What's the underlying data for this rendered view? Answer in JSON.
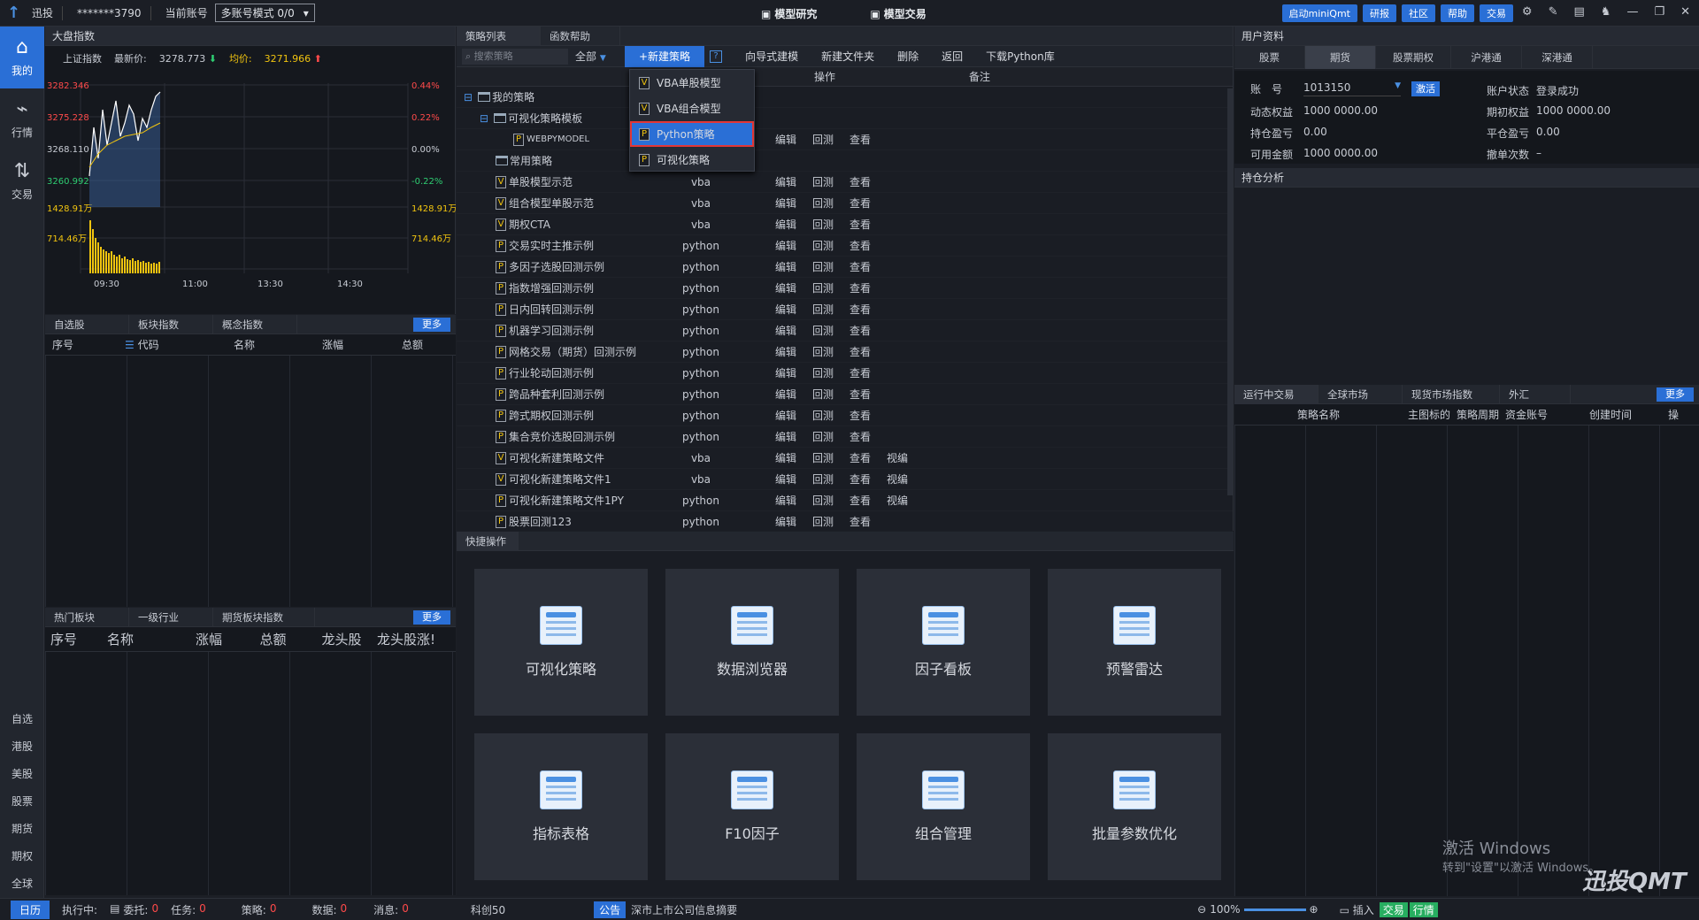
{
  "titlebar": {
    "app_name": "迅投",
    "account_masked": "*******3790",
    "current_account_label": "当前账号",
    "account_mode": "多账号模式 0/0",
    "tabs": [
      "模型研究",
      "模型交易"
    ],
    "buttons": [
      "启动miniQmt",
      "研报",
      "社区",
      "帮助",
      "交易"
    ]
  },
  "leftnav": {
    "items": [
      {
        "label": "我的",
        "icon": "home-icon"
      },
      {
        "label": "行情",
        "icon": "chart-icon"
      },
      {
        "label": "交易",
        "icon": "trade-icon"
      }
    ],
    "bottom_items": [
      "自选",
      "港股",
      "美股",
      "股票",
      "期货",
      "期权",
      "全球"
    ]
  },
  "market": {
    "title": "大盘指数",
    "index_name": "上证指数",
    "last_label": "最新价:",
    "last_value": "3278.773",
    "avg_label": "均价:",
    "avg_value": "3271.966",
    "y_left": [
      "3282.346",
      "3275.228",
      "3268.110",
      "3260.992",
      "1428.91万",
      "714.46万"
    ],
    "y_right": [
      "0.44%",
      "0.22%",
      "0.00%",
      "-0.22%",
      "1428.91万",
      "714.46万"
    ],
    "x_ticks": [
      "09:30",
      "11:00",
      "13:30",
      "14:30"
    ]
  },
  "watch": {
    "tabs": [
      "自选股",
      "板块指数",
      "概念指数"
    ],
    "more": "更多",
    "columns": [
      "序号",
      "代码",
      "名称",
      "涨幅",
      "总额"
    ]
  },
  "hot": {
    "tabs": [
      "热门板块",
      "一级行业",
      "期货板块指数"
    ],
    "more": "更多",
    "columns": [
      "序号",
      "名称",
      "涨幅",
      "总额",
      "龙头股",
      "龙头股涨!"
    ]
  },
  "strategy": {
    "tabs": [
      "策略列表",
      "函数帮助"
    ],
    "search_placeholder": "搜索策略",
    "filter": "全部",
    "new_button": "+新建策略",
    "help_icon": "?",
    "toolbar": [
      "向导式建模",
      "新建文件夹",
      "删除",
      "返回",
      "下载Python库"
    ],
    "columns": [
      "操作",
      "备注"
    ],
    "tree": [
      {
        "label": "我的策略",
        "type": "folder",
        "level": 0
      },
      {
        "label": "可视化策略模板",
        "type": "folder",
        "level": 1
      },
      {
        "label": "WEBPYMODEL",
        "type": "P",
        "level": 2,
        "lang": "",
        "ops": [
          "编辑",
          "回测",
          "查看"
        ]
      },
      {
        "label": "常用策略",
        "type": "folder",
        "level": 1
      }
    ],
    "rows": [
      {
        "name": "单股模型示范",
        "icon": "V",
        "lang": "vba",
        "ops": [
          "编辑",
          "回测",
          "查看"
        ]
      },
      {
        "name": "组合模型单股示范",
        "icon": "V",
        "lang": "vba",
        "ops": [
          "编辑",
          "回测",
          "查看"
        ]
      },
      {
        "name": "期权CTA",
        "icon": "V",
        "lang": "vba",
        "ops": [
          "编辑",
          "回测",
          "查看"
        ]
      },
      {
        "name": "交易实时主推示例",
        "icon": "P",
        "lang": "python",
        "ops": [
          "编辑",
          "回测",
          "查看"
        ]
      },
      {
        "name": "多因子选股回测示例",
        "icon": "P",
        "lang": "python",
        "ops": [
          "编辑",
          "回测",
          "查看"
        ]
      },
      {
        "name": "指数增强回测示例",
        "icon": "P",
        "lang": "python",
        "ops": [
          "编辑",
          "回测",
          "查看"
        ]
      },
      {
        "name": "日内回转回测示例",
        "icon": "P",
        "lang": "python",
        "ops": [
          "编辑",
          "回测",
          "查看"
        ]
      },
      {
        "name": "机器学习回测示例",
        "icon": "P",
        "lang": "python",
        "ops": [
          "编辑",
          "回测",
          "查看"
        ]
      },
      {
        "name": "网格交易（期货）回测示例",
        "icon": "P",
        "lang": "python",
        "ops": [
          "编辑",
          "回测",
          "查看"
        ]
      },
      {
        "name": "行业轮动回测示例",
        "icon": "P",
        "lang": "python",
        "ops": [
          "编辑",
          "回测",
          "查看"
        ]
      },
      {
        "name": "跨品种套利回测示例",
        "icon": "P",
        "lang": "python",
        "ops": [
          "编辑",
          "回测",
          "查看"
        ]
      },
      {
        "name": "跨式期权回测示例",
        "icon": "P",
        "lang": "python",
        "ops": [
          "编辑",
          "回测",
          "查看"
        ]
      },
      {
        "name": "集合竞价选股回测示例",
        "icon": "P",
        "lang": "python",
        "ops": [
          "编辑",
          "回测",
          "查看"
        ]
      },
      {
        "name": "可视化新建策略文件",
        "icon": "V",
        "lang": "vba",
        "ops": [
          "编辑",
          "回测",
          "查看",
          "视编"
        ]
      },
      {
        "name": "可视化新建策略文件1",
        "icon": "V",
        "lang": "vba",
        "ops": [
          "编辑",
          "回测",
          "查看",
          "视编"
        ]
      },
      {
        "name": "可视化新建策略文件1PY",
        "icon": "P",
        "lang": "python",
        "ops": [
          "编辑",
          "回测",
          "查看",
          "视编"
        ]
      },
      {
        "name": "股票回测123",
        "icon": "P",
        "lang": "python",
        "ops": [
          "编辑",
          "回测",
          "查看"
        ]
      }
    ],
    "menu": [
      {
        "label": "VBA单股模型",
        "icon": "V"
      },
      {
        "label": "VBA组合模型",
        "icon": "V"
      },
      {
        "label": "Python策略",
        "icon": "P",
        "selected": true
      },
      {
        "label": "可视化策略",
        "icon": "P"
      }
    ]
  },
  "quick": {
    "title": "快捷操作",
    "cards": [
      "可视化策略",
      "数据浏览器",
      "因子看板",
      "预警雷达",
      "指标表格",
      "F10因子",
      "组合管理",
      "批量参数优化"
    ]
  },
  "user": {
    "title": "用户资料",
    "tabs": [
      "股票",
      "期货",
      "股票期权",
      "沪港通",
      "深港通"
    ],
    "account_label": "账　号",
    "account_value": "1013150",
    "activate": "激活",
    "status_label": "账户状态",
    "status_value": "登录成功",
    "fields_left": [
      {
        "k": "动态权益",
        "v": "1000 0000.00"
      },
      {
        "k": "持仓盈亏",
        "v": "0.00"
      },
      {
        "k": "可用金额",
        "v": "1000 0000.00"
      }
    ],
    "fields_right": [
      {
        "k": "期初权益",
        "v": "1000 0000.00"
      },
      {
        "k": "平仓盈亏",
        "v": "0.00"
      },
      {
        "k": "撤单次数",
        "v": "–"
      }
    ],
    "analysis": "持仓分析"
  },
  "running": {
    "tabs": [
      "运行中交易",
      "全球市场",
      "现货市场指数",
      "外汇"
    ],
    "more": "更多",
    "columns": [
      "策略名称",
      "主图标的",
      "策略周期",
      "资金账号",
      "创建时间",
      "操"
    ]
  },
  "statusbar": {
    "date": "日历",
    "items": [
      {
        "k": "执行中:",
        "v": ""
      },
      {
        "k": "委托:",
        "v": "0"
      },
      {
        "k": "任务:",
        "v": "0"
      },
      {
        "k": "策略:",
        "v": "0"
      },
      {
        "k": "数据:",
        "v": "0"
      },
      {
        "k": "消息:",
        "v": "0"
      }
    ],
    "ticker": "科创50",
    "notice_tag": "公告",
    "notice": "深市上市公司信息摘要",
    "zoom": "100%",
    "right": [
      "插入",
      "交易",
      "行情"
    ]
  },
  "watermark": {
    "line1": "激活 Windows",
    "line2": "转到\"设置\"以激活 Windows。",
    "brand": "迅投QMT"
  }
}
